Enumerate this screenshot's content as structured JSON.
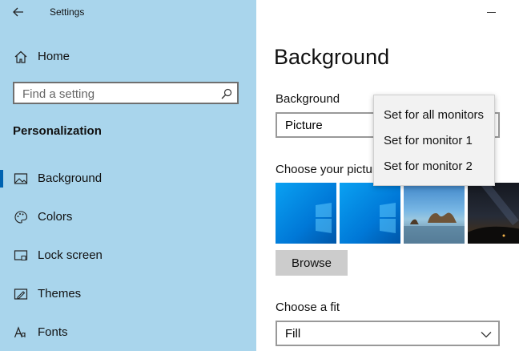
{
  "window": {
    "title": "Settings"
  },
  "sidebar": {
    "home_label": "Home",
    "search_placeholder": "Find a setting",
    "section_title": "Personalization",
    "items": [
      {
        "label": "Background",
        "icon": "picture-icon",
        "selected": true
      },
      {
        "label": "Colors",
        "icon": "palette-icon"
      },
      {
        "label": "Lock screen",
        "icon": "lock-screen-icon"
      },
      {
        "label": "Themes",
        "icon": "themes-icon"
      },
      {
        "label": "Fonts",
        "icon": "fonts-icon"
      }
    ]
  },
  "main": {
    "title": "Background",
    "background_label": "Background",
    "background_value": "Picture",
    "choose_picture_label": "Choose your picture",
    "browse_label": "Browse",
    "fit_label": "Choose a fit",
    "fit_value": "Fill"
  },
  "context_menu": {
    "items": [
      "Set for all monitors",
      "Set for monitor 1",
      "Set for monitor 2"
    ]
  },
  "colors": {
    "sidebar_bg": "#a9d5ec",
    "accent": "#0063b1"
  }
}
